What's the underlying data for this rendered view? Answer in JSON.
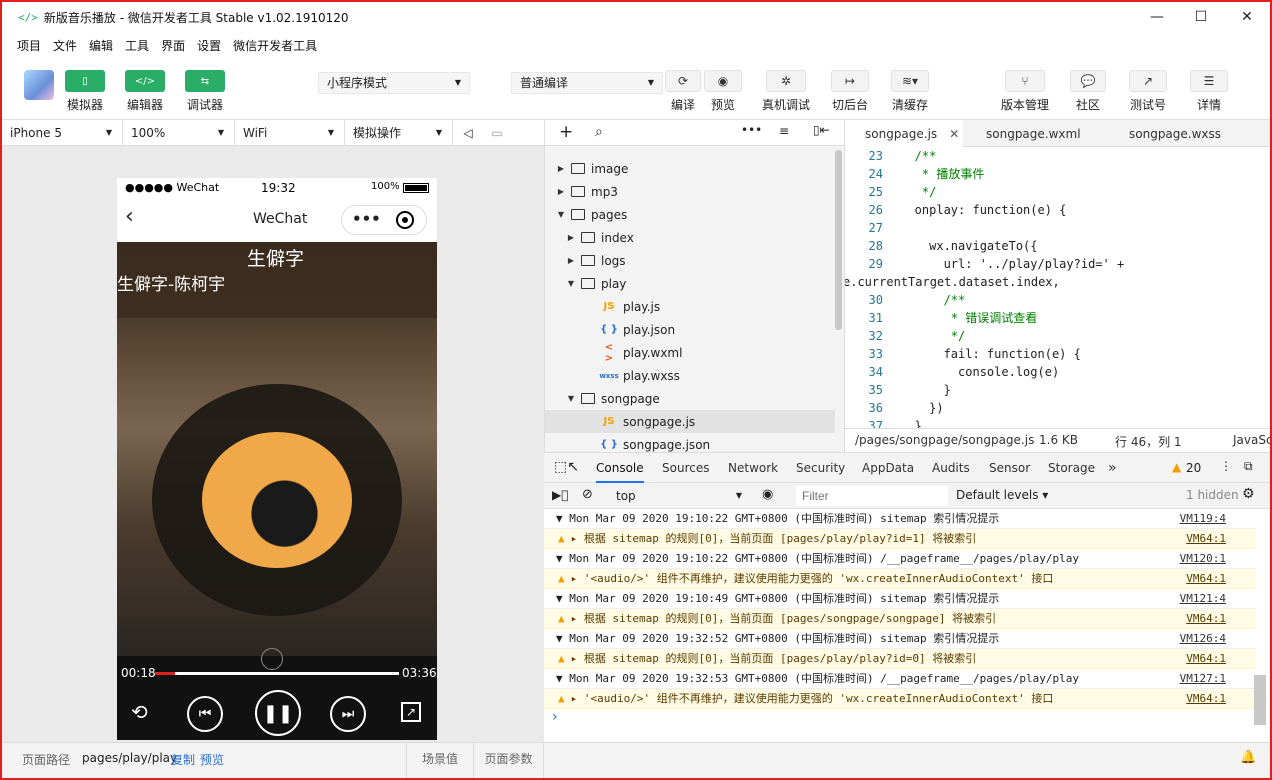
{
  "window": {
    "title": "新版音乐播放 - 微信开发者工具 Stable v1.02.1910120",
    "icon": "</>",
    "minimize": "—",
    "maximize": "☐",
    "close": "✕"
  },
  "menu": [
    "项目",
    "文件",
    "编辑",
    "工具",
    "界面",
    "设置",
    "微信开发者工具"
  ],
  "toolbar": {
    "simulator": "模拟器",
    "editor": "编辑器",
    "debugger": "调试器",
    "mode": "小程序模式",
    "compile_mode": "普通编译",
    "compile": "编译",
    "preview": "预览",
    "remote_debug": "真机调试",
    "background": "切后台",
    "clear_cache": "清缓存",
    "version": "版本管理",
    "community": "社区",
    "test": "测试号",
    "details": "详情"
  },
  "device": {
    "model": "iPhone 5",
    "zoom": "100%",
    "network": "WiFi",
    "operation": "模拟操作"
  },
  "phone": {
    "carrier": "●●●●● WeChat",
    "time": "19:32",
    "battery": "100%",
    "nav_title": "WeChat",
    "song_title": "生僻字",
    "song_artist": "生僻字-陈柯宇",
    "current_time": "00:18",
    "duration": "03:36",
    "progress": 0.08
  },
  "explorer": {
    "items": [
      {
        "label": "image",
        "type": "folder",
        "open": false,
        "depth": 0
      },
      {
        "label": "mp3",
        "type": "folder",
        "open": false,
        "depth": 0
      },
      {
        "label": "pages",
        "type": "folder",
        "open": true,
        "depth": 0
      },
      {
        "label": "index",
        "type": "folder",
        "open": false,
        "depth": 1
      },
      {
        "label": "logs",
        "type": "folder",
        "open": false,
        "depth": 1
      },
      {
        "label": "play",
        "type": "folder",
        "open": true,
        "depth": 1
      },
      {
        "label": "play.js",
        "type": "js",
        "depth": 2
      },
      {
        "label": "play.json",
        "type": "json",
        "depth": 2
      },
      {
        "label": "play.wxml",
        "type": "wxml",
        "depth": 2
      },
      {
        "label": "play.wxss",
        "type": "wxss",
        "depth": 2
      },
      {
        "label": "songpage",
        "type": "folder",
        "open": true,
        "depth": 1
      },
      {
        "label": "songpage.js",
        "type": "js",
        "depth": 2,
        "selected": true
      },
      {
        "label": "songpage.json",
        "type": "json",
        "depth": 2
      }
    ],
    "icons": {
      "js": "JS",
      "json": "{ }",
      "wxml": "< >",
      "wxss": "wxss"
    }
  },
  "editor": {
    "tabs": [
      "songpage.js",
      "songpage.wxml",
      "songpage.wxss"
    ],
    "lines": [
      {
        "n": "23",
        "t": "   /**",
        "c": "cm"
      },
      {
        "n": "24",
        "t": "    * 播放事件",
        "c": "cm"
      },
      {
        "n": "25",
        "t": "    */",
        "c": "cm"
      },
      {
        "n": "26",
        "t": "   onplay: function(e) {",
        "c": ""
      },
      {
        "n": "27",
        "t": "",
        "c": ""
      },
      {
        "n": "28",
        "t": "     wx.navigateTo({",
        "c": ""
      },
      {
        "n": "29",
        "t": "       url: '../play/play?id=' +",
        "c": ""
      },
      {
        "n": "",
        "t": "e.currentTarget.dataset.index,",
        "c": ""
      },
      {
        "n": "30",
        "t": "       /**",
        "c": "cm"
      },
      {
        "n": "31",
        "t": "        * 错误调试查看",
        "c": "cm"
      },
      {
        "n": "32",
        "t": "        */",
        "c": "cm"
      },
      {
        "n": "33",
        "t": "       fail: function(e) {",
        "c": ""
      },
      {
        "n": "34",
        "t": "         console.log(e)",
        "c": ""
      },
      {
        "n": "35",
        "t": "       }",
        "c": ""
      },
      {
        "n": "36",
        "t": "     })",
        "c": ""
      },
      {
        "n": "37",
        "t": "   },",
        "c": ""
      }
    ],
    "path": "/pages/songpage/songpage.js",
    "size": "1.6 KB",
    "cursor": "行 46，列 1",
    "lang": "JavaSc"
  },
  "console": {
    "tabs": [
      "Console",
      "Sources",
      "Network",
      "Security",
      "AppData",
      "Audits",
      "Sensor",
      "Storage"
    ],
    "more": "»",
    "warnings": "20",
    "context": "top",
    "filter_placeholder": "Filter",
    "levels": "Default levels",
    "hidden": "1 hidden",
    "logs": [
      {
        "type": "group",
        "text": "▼ Mon Mar 09 2020 19:10:22 GMT+0800 (中国标准时间) sitemap 索引情况提示",
        "src": "VM119:4"
      },
      {
        "type": "warn",
        "text": "▸ 根据 sitemap 的规则[0]，当前页面 [pages/play/play?id=1] 将被索引",
        "src": "VM64:1"
      },
      {
        "type": "group",
        "text": "▼ Mon Mar 09 2020 19:10:22 GMT+0800 (中国标准时间) /__pageframe__/pages/play/play",
        "src": "VM120:1"
      },
      {
        "type": "warn",
        "text": "▸ '<audio/>' 组件不再维护，建议使用能力更强的 'wx.createInnerAudioContext' 接口",
        "src": "VM64:1"
      },
      {
        "type": "group",
        "text": "▼ Mon Mar 09 2020 19:10:49 GMT+0800 (中国标准时间) sitemap 索引情况提示",
        "src": "VM121:4"
      },
      {
        "type": "warn",
        "text": "▸ 根据 sitemap 的规则[0]，当前页面 [pages/songpage/songpage] 将被索引",
        "src": "VM64:1"
      },
      {
        "type": "group",
        "text": "▼ Mon Mar 09 2020 19:32:52 GMT+0800 (中国标准时间) sitemap 索引情况提示",
        "src": "VM126:4"
      },
      {
        "type": "warn",
        "text": "▸ 根据 sitemap 的规则[0]，当前页面 [pages/play/play?id=0] 将被索引",
        "src": "VM64:1"
      },
      {
        "type": "group",
        "text": "▼ Mon Mar 09 2020 19:32:53 GMT+0800 (中国标准时间) /__pageframe__/pages/play/play",
        "src": "VM127:1"
      },
      {
        "type": "warn",
        "text": "▸ '<audio/>' 组件不再维护，建议使用能力更强的 'wx.createInnerAudioContext' 接口",
        "src": "VM64:1"
      }
    ],
    "prompt": "›"
  },
  "bottom": {
    "path_label": "页面路径",
    "path": "pages/play/play",
    "copy": "复制",
    "preview": "预览",
    "scene": "场景值",
    "params": "页面参数"
  }
}
